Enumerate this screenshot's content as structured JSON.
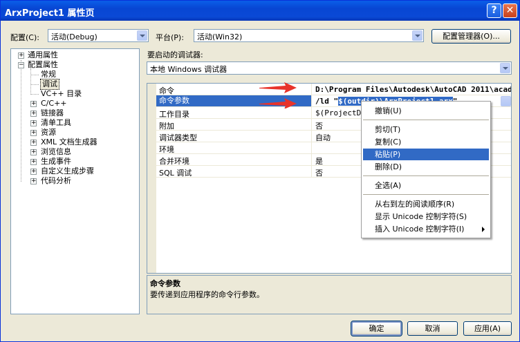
{
  "window": {
    "title": "ArxProject1 属性页",
    "help_glyph": "?",
    "close_glyph": "✕"
  },
  "config": {
    "label": "配置(C):",
    "value": "活动(Debug)"
  },
  "platform": {
    "label": "平台(P):",
    "value": "活动(Win32)"
  },
  "config_manager_label": "配置管理器(O)...",
  "tree": {
    "items": [
      {
        "label": "通用属性",
        "expander": "+"
      },
      {
        "label": "配置属性",
        "expander": "−"
      },
      {
        "label": "常规"
      },
      {
        "label": "调试"
      },
      {
        "label": "VC++ 目录"
      },
      {
        "label": "C/C++",
        "expander": "+"
      },
      {
        "label": "链接器",
        "expander": "+"
      },
      {
        "label": "清单工具",
        "expander": "+"
      },
      {
        "label": "资源",
        "expander": "+"
      },
      {
        "label": "XML 文档生成器",
        "expander": "+"
      },
      {
        "label": "浏览信息",
        "expander": "+"
      },
      {
        "label": "生成事件",
        "expander": "+"
      },
      {
        "label": "自定义生成步骤",
        "expander": "+"
      },
      {
        "label": "代码分析",
        "expander": "+"
      }
    ]
  },
  "debugger": {
    "label": "要启动的调试器:",
    "value": "本地 Windows 调试器"
  },
  "grid": {
    "rows": [
      {
        "name": "命令",
        "value": "D:\\Program Files\\Autodesk\\AutoCAD 2011\\acad"
      },
      {
        "name": "命令参数",
        "value_prefix": "/ld \"",
        "value_selected": "$(outdir)\\ArxProject1.arx",
        "value_suffix": "\""
      },
      {
        "name": "工作目录",
        "value": "$(ProjectDir)"
      },
      {
        "name": "附加",
        "value": "否"
      },
      {
        "name": "调试器类型",
        "value": "自动"
      },
      {
        "name": "环境",
        "value": ""
      },
      {
        "name": "合并环境",
        "value": "是"
      },
      {
        "name": "SQL 调试",
        "value": "否"
      }
    ]
  },
  "context_menu": {
    "items": [
      {
        "label": "撤销(U)"
      },
      {
        "label": "剪切(T)"
      },
      {
        "label": "复制(C)"
      },
      {
        "label": "粘贴(P)"
      },
      {
        "label": "删除(D)"
      },
      {
        "label": "全选(A)"
      },
      {
        "label": "从右到左的阅读顺序(R)"
      },
      {
        "label": "显示 Unicode 控制字符(S)"
      },
      {
        "label": "插入 Unicode 控制字符(I)"
      }
    ]
  },
  "description": {
    "title": "命令参数",
    "text": "要传递到应用程序的命令行参数。"
  },
  "buttons": {
    "ok": "确定",
    "cancel": "取消",
    "apply": "应用(A)"
  },
  "colors": {
    "titlebar": "#0a5ee8",
    "selection": "#316ac5",
    "arrow": "#e8332a",
    "face": "#ece9d8"
  }
}
